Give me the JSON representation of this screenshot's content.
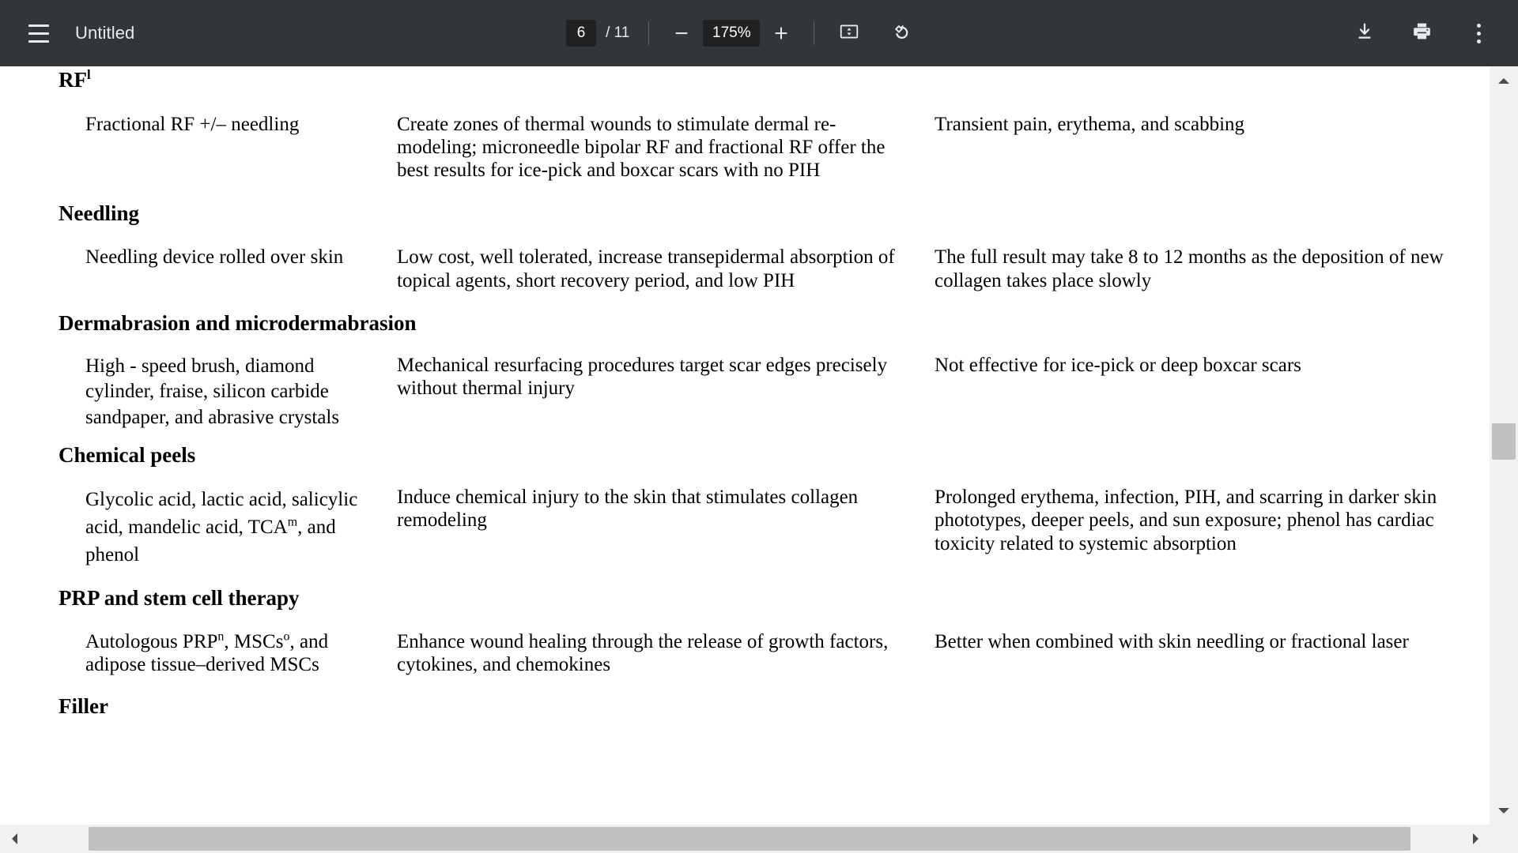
{
  "toolbar": {
    "menu_icon": "hamburger-menu-icon",
    "title": "Untitled",
    "page_current": "6",
    "page_total": "/ 11",
    "zoom_out_icon": "minus-icon",
    "zoom_level": "175%",
    "zoom_in_icon": "plus-icon",
    "fit_icon": "fit-to-page-icon",
    "rotate_icon": "rotate-counterclockwise-icon",
    "download_icon": "download-icon",
    "print_icon": "print-icon",
    "more_icon": "more-options-icon"
  },
  "scrollbars": {
    "v_up_icon": "scroll-up-arrow-icon",
    "v_down_icon": "scroll-down-arrow-icon",
    "h_left_icon": "scroll-left-arrow-icon",
    "h_right_icon": "scroll-right-arrow-icon"
  },
  "document": {
    "sections": [
      {
        "heading": "RF",
        "heading_sup": "l",
        "treatment": "Fractional RF +/– needling",
        "mechanism": "Create zones of thermal wounds to stimulate dermal re-modeling; microneedle bipolar RF and fractional RF offer the best results for ice-pick and boxcar scars with no PIH",
        "adverse": "Transient pain, erythema, and scabbing"
      },
      {
        "heading": "Needling",
        "heading_sup": "",
        "treatment": "Needling device rolled over skin",
        "mechanism": "Low cost, well tolerated, increase transepidermal absorption of topical agents, short recovery period, and low PIH",
        "adverse": "The full result may take 8 to 12 months as the deposition of new collagen takes place slowly"
      },
      {
        "heading": "Dermabrasion and microdermabrasion",
        "heading_sup": "",
        "treatment": "High ‐ speed brush, diamond cylinder, fraise, silicon carbide sandpaper, and abrasive crystals",
        "mechanism": "Mechanical resurfacing procedures target scar edges precisely without thermal injury",
        "adverse": "Not effective for ice-pick or deep boxcar scars"
      },
      {
        "heading": "Chemical peels",
        "heading_sup": "",
        "treatment_pre": "Glycolic acid, lactic acid, salicylic acid, mandelic acid, TCA",
        "treatment_sup": "m",
        "treatment_post": ", and phenol",
        "mechanism": "Induce chemical injury to the skin that stimulates collagen remodeling",
        "adverse": "Prolonged erythema, infection, PIH, and scarring in darker skin phototypes, deeper peels, and sun exposure; phenol has cardiac toxicity related to systemic absorption"
      },
      {
        "heading": "PRP and stem cell therapy",
        "heading_sup": "",
        "treatment_pre": "Autologous PRP",
        "treatment_sup": "n",
        "treatment_mid": ", MSCs",
        "treatment_sup2": "o",
        "treatment_post": ", and adipose tissue–derived MSCs",
        "mechanism": "Enhance wound healing through the release of growth factors, cytokines, and chemokines",
        "adverse": "Better when combined with skin needling or fractional laser"
      },
      {
        "heading": "Filler",
        "heading_sup": "",
        "treatment": "",
        "mechanism": "",
        "adverse": ""
      }
    ]
  },
  "colors": {
    "toolbar_bg": "#323639",
    "toolbar_text": "#e8eaed",
    "field_bg": "#1f2123",
    "page_bg": "#ffffff",
    "scrollbar_track": "#f1f1f1",
    "scrollbar_thumb": "#c1c1c1"
  }
}
